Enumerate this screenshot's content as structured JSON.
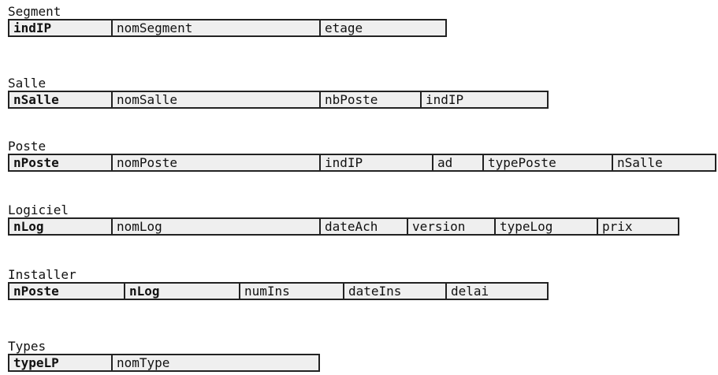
{
  "tables": [
    {
      "name": "Segment",
      "columns": [
        {
          "label": "indIP",
          "key": true
        },
        {
          "label": "nomSegment",
          "key": false
        },
        {
          "label": "etage",
          "key": false
        }
      ]
    },
    {
      "name": "Salle",
      "columns": [
        {
          "label": "nSalle",
          "key": true
        },
        {
          "label": "nomSalle",
          "key": false
        },
        {
          "label": "nbPoste",
          "key": false
        },
        {
          "label": "indIP",
          "key": false
        }
      ]
    },
    {
      "name": "Poste",
      "columns": [
        {
          "label": "nPoste",
          "key": true
        },
        {
          "label": "nomPoste",
          "key": false
        },
        {
          "label": "indIP",
          "key": false
        },
        {
          "label": "ad",
          "key": false
        },
        {
          "label": "typePoste",
          "key": false
        },
        {
          "label": "nSalle",
          "key": false
        }
      ]
    },
    {
      "name": "Logiciel",
      "columns": [
        {
          "label": "nLog",
          "key": true
        },
        {
          "label": "nomLog",
          "key": false
        },
        {
          "label": "dateAch",
          "key": false
        },
        {
          "label": "version",
          "key": false
        },
        {
          "label": "typeLog",
          "key": false
        },
        {
          "label": "prix",
          "key": false
        }
      ]
    },
    {
      "name": "Installer",
      "columns": [
        {
          "label": "nPoste",
          "key": true
        },
        {
          "label": "nLog",
          "key": true
        },
        {
          "label": "numIns",
          "key": false
        },
        {
          "label": "dateIns",
          "key": false
        },
        {
          "label": "delai",
          "key": false
        }
      ]
    },
    {
      "name": "Types",
      "columns": [
        {
          "label": "typeLP",
          "key": true
        },
        {
          "label": "nomType",
          "key": false
        }
      ]
    }
  ]
}
